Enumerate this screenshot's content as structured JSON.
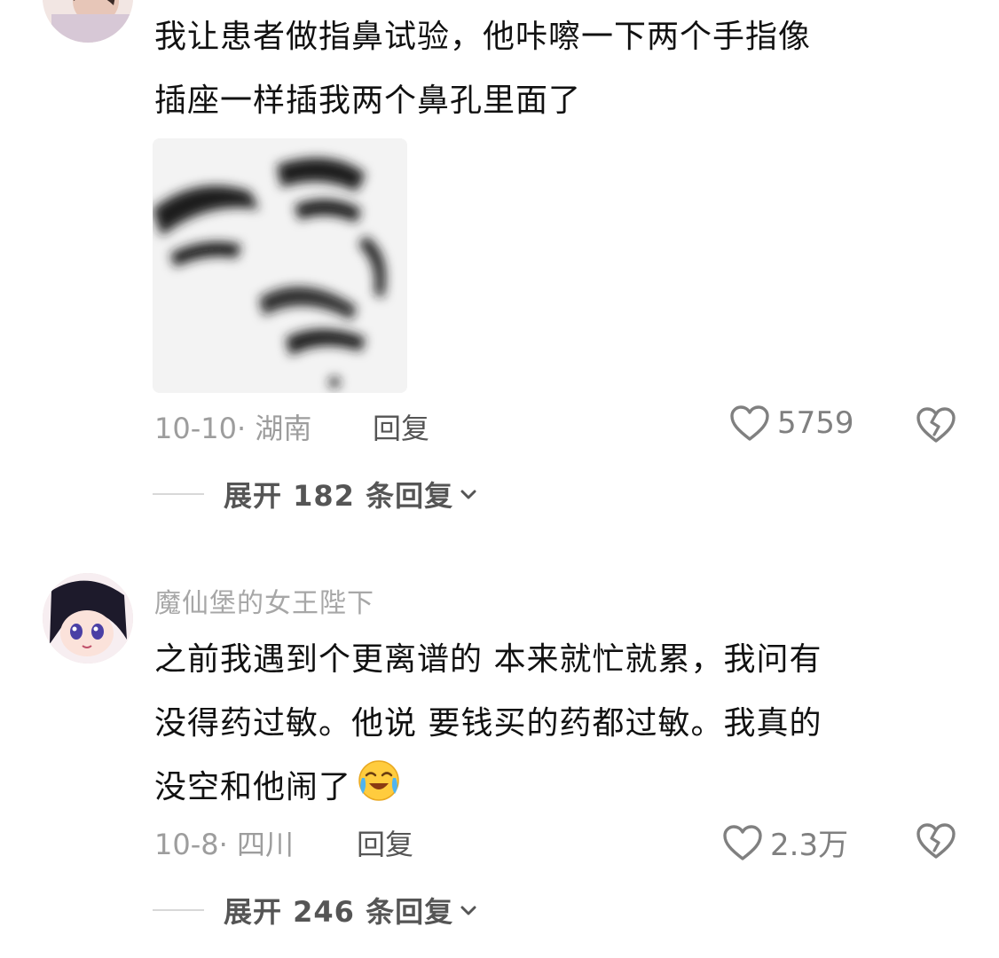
{
  "comments": [
    {
      "author": "",
      "text_lines": [
        "我让患者做指鼻试验，他咔嚓一下两个手指像",
        "插座一样插我两个鼻孔里面了"
      ],
      "date_location": "10-10· 湖南",
      "reply_label": "回复",
      "likes": "5759",
      "expand_label": "展开 182 条回复"
    },
    {
      "author": "魔仙堡的女王陛下",
      "text_lines": [
        "之前我遇到个更离谱的 本来就忙就累，我问有",
        "没得药过敏。他说 要钱买的药都过敏。我真的",
        "没空和他闹了"
      ],
      "date_location": "10-8· 四川",
      "reply_label": "回复",
      "likes": "2.3万",
      "expand_label": "展开 246 条回复"
    }
  ],
  "icons": {
    "like": "heart-outline-icon",
    "dislike": "broken-heart-icon",
    "expand": "chevron-down-icon",
    "emoji": "crying-laughing-emoji-icon"
  },
  "colors": {
    "text": "#111111",
    "meta": "#9d9d9d",
    "author": "#a7a7a7",
    "action": "#555555"
  }
}
